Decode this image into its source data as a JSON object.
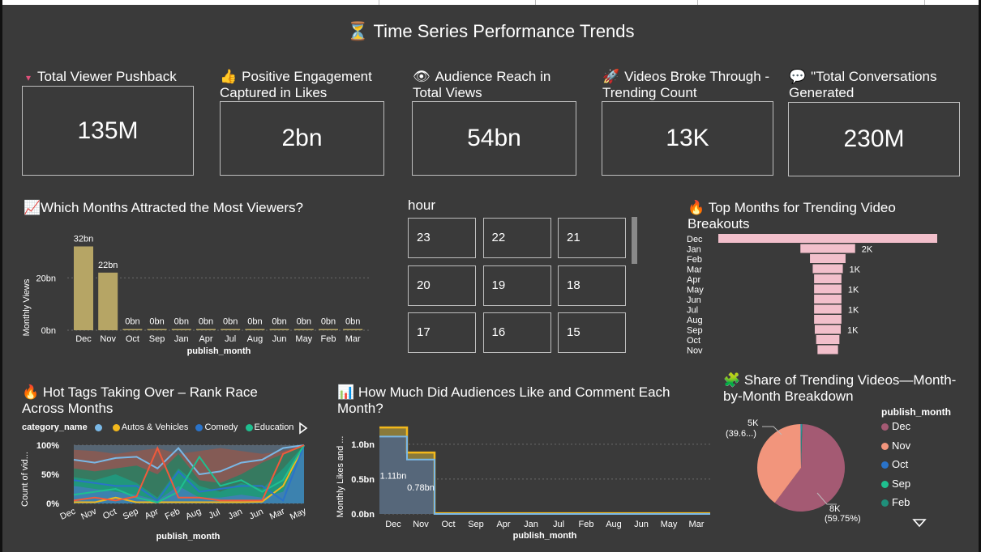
{
  "report": {
    "title": "⏳ Time Series Performance Trends"
  },
  "kpis": [
    {
      "icon": "▾",
      "title": "Total Viewer Pushback",
      "value": "135M"
    },
    {
      "icon": "👍",
      "title": "Positive Engagement Captured in Likes",
      "value": "2bn"
    },
    {
      "icon": "👁",
      "title": "Audience Reach in Total Views",
      "value": "54bn"
    },
    {
      "icon": "🚀",
      "title": "Videos Broke Through - Trending Count",
      "value": "13K"
    },
    {
      "icon": "💬",
      "title": "\"Total Conversations Generated",
      "value": "230M"
    }
  ],
  "views_chart": {
    "title": "📈Which Months Attracted the Most Viewers?",
    "xlabel": "publish_month",
    "ylabel": "Monthly Views"
  },
  "hour_slicer": {
    "label": "hour",
    "values": [
      "23",
      "22",
      "21",
      "20",
      "19",
      "18",
      "17",
      "16",
      "15"
    ]
  },
  "trending_chart": {
    "title": "🔥 Top Months for Trending Video Breakouts"
  },
  "tags_chart": {
    "title": "🔥 Hot Tags Taking Over – Rank Race Across Months",
    "legend_label": "category_name",
    "legend_items": [
      {
        "name": "",
        "color": "#7ab8e6"
      },
      {
        "name": "Autos & Vehicles",
        "color": "#f2b81c"
      },
      {
        "name": "Comedy",
        "color": "#2a73c9"
      },
      {
        "name": "Education",
        "color": "#1fbf8f"
      }
    ],
    "xlabel": "publish_month",
    "ylabel": "Count of vid..."
  },
  "likes_chart": {
    "title": "📊 How Much Did Audiences Like and Comment Each Month?",
    "xlabel": "publish_month",
    "ylabel": "Monthly Likes and ..."
  },
  "pie_chart": {
    "title": "🧩 Share of Trending Videos—Month-by-Month Breakdown",
    "legend_title": "publish_month",
    "legend": [
      {
        "name": "Dec",
        "color": "#a45a73"
      },
      {
        "name": "Nov",
        "color": "#f2957c"
      },
      {
        "name": "Oct",
        "color": "#2a73c9"
      },
      {
        "name": "Sep",
        "color": "#1fbf8f"
      },
      {
        "name": "Feb",
        "color": "#1f8f7a"
      }
    ],
    "label_a": "5K",
    "label_a2": "(39.6...)",
    "label_b": "8K",
    "label_b2": "(59.75%)"
  },
  "chart_data": [
    {
      "type": "bar",
      "title": "Which Months Attracted the Most Viewers?",
      "xlabel": "publish_month",
      "ylabel": "Monthly Views",
      "categories": [
        "Dec",
        "Nov",
        "Oct",
        "Sep",
        "Jan",
        "Apr",
        "Jul",
        "Aug",
        "Jun",
        "May",
        "Feb",
        "Mar"
      ],
      "values": [
        32,
        22,
        0,
        0,
        0,
        0,
        0,
        0,
        0,
        0,
        0,
        0
      ],
      "data_labels": [
        "32bn",
        "22bn",
        "0bn",
        "0bn",
        "0bn",
        "0bn",
        "0bn",
        "0bn",
        "0bn",
        "0bn",
        "0bn",
        "0bn"
      ],
      "yticks": [
        "0bn",
        "20bn"
      ],
      "ylim": [
        0,
        34
      ],
      "color": "#b6a565"
    },
    {
      "type": "bar",
      "title": "Top Months for Trending Video Breakouts",
      "orientation": "funnel",
      "categories": [
        "Dec",
        "Jan",
        "Feb",
        "Mar",
        "Apr",
        "May",
        "Jun",
        "Jul",
        "Aug",
        "Sep",
        "Oct",
        "Nov"
      ],
      "values": [
        8000,
        2000,
        1300,
        1100,
        1000,
        1000,
        1000,
        1000,
        1000,
        950,
        850,
        750
      ],
      "data_labels": [
        "",
        "2K",
        "",
        "1K",
        "",
        "1K",
        "",
        "1K",
        "",
        "1K",
        "",
        ""
      ],
      "color": "#f2bfcb"
    },
    {
      "type": "area",
      "title": "Hot Tags Taking Over – Rank Race Across Months",
      "xlabel": "publish_month",
      "yticks": [
        "0%",
        "50%",
        "100%"
      ],
      "categories": [
        "Dec",
        "Nov",
        "Oct",
        "Sep",
        "Apr",
        "Feb",
        "Aug",
        "Jul",
        "Jan",
        "Jun",
        "Mar",
        "May"
      ]
    },
    {
      "type": "line",
      "title": "How Much Did Audiences Like and Comment Each Month?",
      "xlabel": "publish_month",
      "categories": [
        "Dec",
        "Nov",
        "Oct",
        "Sep",
        "Apr",
        "Jan",
        "Jul",
        "Feb",
        "Aug",
        "Jun",
        "May",
        "Mar"
      ],
      "series": [
        {
          "name": "",
          "values": [
            1.11,
            0.78,
            0,
            0,
            0,
            0,
            0,
            0,
            0,
            0,
            0,
            0
          ],
          "color": "#7ab8e6"
        },
        {
          "name": "",
          "values": [
            1.24,
            0.88,
            0.01,
            0.01,
            0.01,
            0.01,
            0.01,
            0.01,
            0.01,
            0.01,
            0.01,
            0.01
          ],
          "color": "#f2b81c"
        }
      ],
      "data_labels": [
        "1.11bn",
        "0.78bn"
      ],
      "yticks": [
        "0.0bn",
        "0.5bn",
        "1.0bn"
      ],
      "ylim": [
        0,
        1.3
      ]
    },
    {
      "type": "pie",
      "title": "Share of Trending Videos—Month-by-Month Breakdown",
      "categories": [
        "Dec",
        "Nov",
        "Oct",
        "Sep",
        "Feb"
      ],
      "values": [
        59.75,
        39.6,
        0.3,
        0.2,
        0.15
      ],
      "labels": [
        "8K (59.75%)",
        "5K (39.6...)"
      ]
    }
  ]
}
